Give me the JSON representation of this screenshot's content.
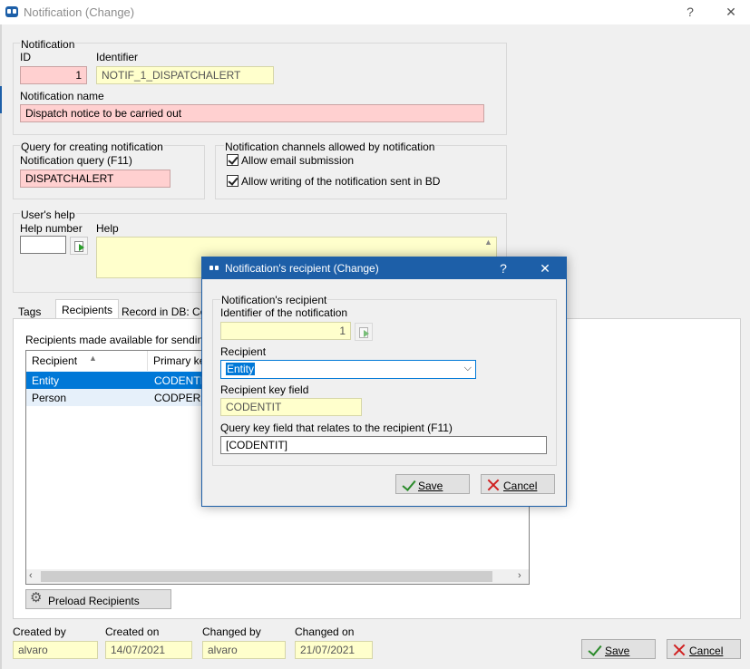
{
  "window": {
    "title": "Notification (Change)",
    "help": "?",
    "close": "✕"
  },
  "notification": {
    "group_label": "Notification",
    "id_label": "ID",
    "id_value": "1",
    "identifier_label": "Identifier",
    "identifier_value": "NOTIF_1_DISPATCHALERT",
    "name_label": "Notification name",
    "name_value": "Dispatch notice to be carried out"
  },
  "query": {
    "group_label": "Query for creating notification",
    "field_label": "Notification query (F11)",
    "field_value": "DISPATCHALERT"
  },
  "channels": {
    "group_label": "Notification channels allowed by notification",
    "email_label": "Allow email submission",
    "bd_label": "Allow writing of the notification sent in BD"
  },
  "help": {
    "group_label": "User's help",
    "number_label": "Help number",
    "number_value": "",
    "text_label": "Help",
    "text_value": ""
  },
  "tabs": [
    "Tags",
    "Recipients",
    "Record in DB: Co"
  ],
  "recipients": {
    "caption": "Recipients made available for sending",
    "columns": [
      "Recipient",
      "Primary ke"
    ],
    "rows": [
      {
        "recipient": "Entity",
        "key": "CODENTIT"
      },
      {
        "recipient": "Person",
        "key": "CODPERSO"
      }
    ],
    "preload_label": "Preload Recipients"
  },
  "audit": {
    "created_by_label": "Created by",
    "created_by_value": "alvaro",
    "created_on_label": "Created on",
    "created_on_value": "14/07/2021",
    "changed_by_label": "Changed by",
    "changed_by_value": "alvaro",
    "changed_on_label": "Changed on",
    "changed_on_value": "21/07/2021"
  },
  "main_buttons": {
    "save": "Save",
    "cancel": "Cancel"
  },
  "dialog": {
    "title": "Notification's recipient (Change)",
    "help": "?",
    "close": "✕",
    "group_label": "Notification's recipient",
    "notif_id_label": "Identifier of the notification",
    "notif_id_value": "1",
    "recipient_label": "Recipient",
    "recipient_value": "Entity",
    "key_field_label": "Recipient key field",
    "key_field_value": "CODENTIT",
    "query_key_label": "Query key field that relates to the recipient (F11)",
    "query_key_value": "[CODENTIT]",
    "save": "Save",
    "cancel": "Cancel"
  },
  "colors": {
    "accent": "#1d5fa8",
    "selection": "#0078d7",
    "required": "#ffd0d0",
    "readonly": "#ffffcc"
  }
}
